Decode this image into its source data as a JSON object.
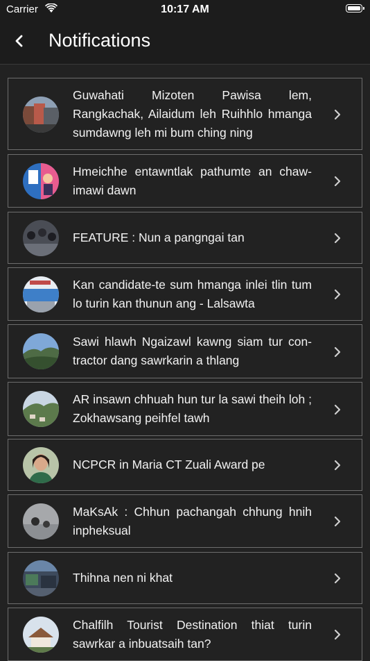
{
  "status_bar": {
    "carrier": "Carrier",
    "time": "10:17 AM"
  },
  "header": {
    "title": "Notifications"
  },
  "icons": {
    "back": "chevron-left-icon",
    "item_arrow": "chevron-right-icon",
    "wifi": "wifi-icon",
    "battery": "battery-icon"
  },
  "notifications": [
    {
      "text": "Guwahati Mizoten Pawisa lem, Rangkachak, Ailaidum leh Ruihhlo hmanga sumdawng leh mi bum ching ning"
    },
    {
      "text": "Hmeichhe entawntlak pathumte an chaw-imawi dawn"
    },
    {
      "text": "FEATURE : Nun a pangngai tan"
    },
    {
      "text": "Kan candidate-te sum hmanga inlei tlin tum lo turin kan thunun ang - Lalsawta"
    },
    {
      "text": "Sawi hlawh Ngaizawl kawng siam tur con-tractor dang sawrkarin a thlang"
    },
    {
      "text": "AR insawn chhuah hun tur la sawi theih loh ; Zokhawsang peihfel tawh"
    },
    {
      "text": "NCPCR in Maria CT Zuali Award pe"
    },
    {
      "text": "MaKsAk : Chhun pachangah chhung hnih inpheksual"
    },
    {
      "text": "Thihna nen ni khat"
    },
    {
      "text": "Chalfilh Tourist Destination thiat turin sawrkar a inbuatsaih tan?"
    }
  ]
}
